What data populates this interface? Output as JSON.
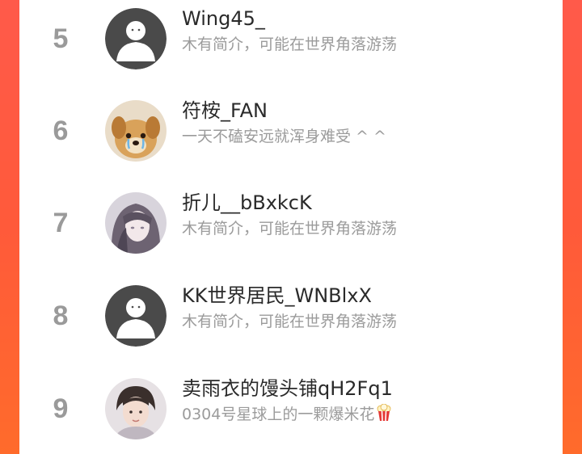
{
  "colors": {
    "background_gradient": [
      "#ff5a4a",
      "#ff6b2b"
    ],
    "panel": "#ffffff",
    "rank": "#9a9a9a",
    "name": "#2a2a2a",
    "bio": "#9b9b9b"
  },
  "rows": [
    {
      "rank": "5",
      "name": "Wing45_",
      "bio": "木有简介，可能在世界角落游荡",
      "avatar": "default-avatar"
    },
    {
      "rank": "6",
      "name": "符桉_FAN",
      "bio": "一天不磕安远就浑身难受 ^ ^",
      "avatar": "puppy-avatar"
    },
    {
      "rank": "7",
      "name": "折儿__bBxkcK",
      "bio": "木有简介，可能在世界角落游荡",
      "avatar": "anime-girl-avatar"
    },
    {
      "rank": "8",
      "name": "KK世界居民_WNBlxX",
      "bio": "木有简介，可能在世界角落游荡",
      "avatar": "default-avatar"
    },
    {
      "rank": "9",
      "name": "卖雨衣的馒头铺qH2Fq1",
      "bio": "0304号星球上的一颗爆米花",
      "avatar": "photo-avatar",
      "bio_icon": "popcorn-icon"
    }
  ]
}
